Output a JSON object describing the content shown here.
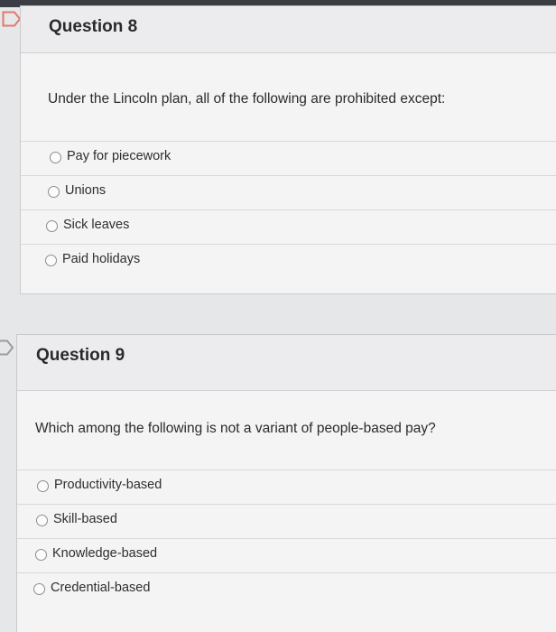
{
  "questions": [
    {
      "title": "Question 8",
      "text": "Under the Lincoln plan, all of the following are prohibited except:",
      "options": [
        "Pay for piecework",
        "Unions",
        "Sick leaves",
        "Paid holidays"
      ]
    },
    {
      "title": "Question 9",
      "text": "Which among the following is not a variant of people-based pay?",
      "options": [
        "Productivity-based",
        "Skill-based",
        "Knowledge-based",
        "Credential-based"
      ]
    }
  ],
  "icons": {
    "flag": "flag-icon",
    "radio": "radio-button-icon"
  },
  "colors": {
    "flag_stroke": "#e07a6a",
    "panel": "#f4f4f5",
    "header": "#ececee"
  }
}
